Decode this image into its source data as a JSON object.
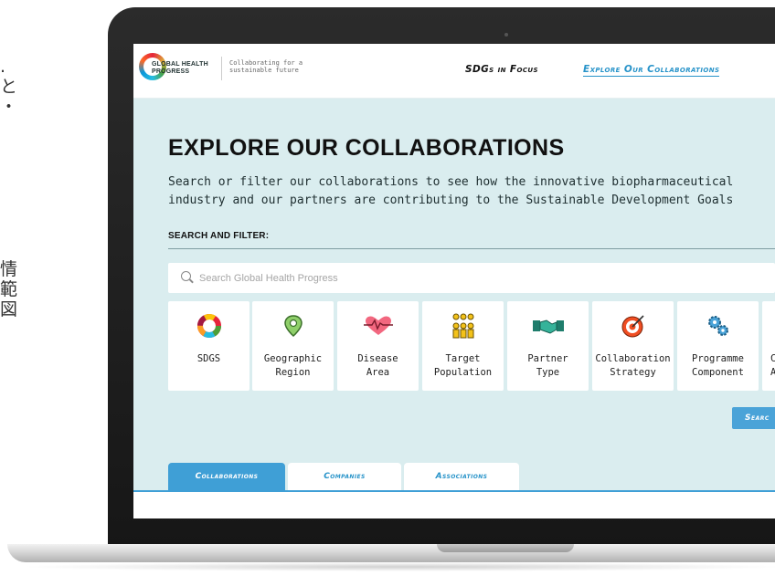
{
  "side_text": {
    "fragment_top": ".\nと\n・",
    "fragment_bottom": "情\n範\n図"
  },
  "header": {
    "logo_text": "GLOBAL HEALTH\nPROGRESS",
    "tagline": "Collaborating for a\nsustainable future",
    "nav": [
      "SDGs in Focus",
      "Explore Our Collaborations"
    ]
  },
  "main": {
    "title": "EXPLORE OUR COLLABORATIONS",
    "description": "Search or filter our collaborations to see how the innovative biopharmaceutical industry and our partners are contributing to the Sustainable Development Goals",
    "search_filter_label": "SEARCH AND FILTER:",
    "search_placeholder": "Search Global Health Progress",
    "filters": [
      {
        "label": "SDGS",
        "icon": "sdg-wheel-icon"
      },
      {
        "label": "Geographic\nRegion",
        "icon": "map-pin-icon"
      },
      {
        "label": "Disease\nArea",
        "icon": "heart-pulse-icon"
      },
      {
        "label": "Target\nPopulation",
        "icon": "people-icon"
      },
      {
        "label": "Partner\nType",
        "icon": "handshake-icon"
      },
      {
        "label": "Collaboration\nStrategy",
        "icon": "target-icon"
      },
      {
        "label": "Programme\nComponent",
        "icon": "gears-icon"
      },
      {
        "label": "C\nA",
        "icon": "partial-icon"
      }
    ],
    "search_button": "Searc",
    "tabs": [
      "Collaborations",
      "Companies",
      "Associations"
    ]
  },
  "colors": {
    "accent": "#2793c9",
    "page_background": "#daedef",
    "button": "#4aa3d8"
  }
}
